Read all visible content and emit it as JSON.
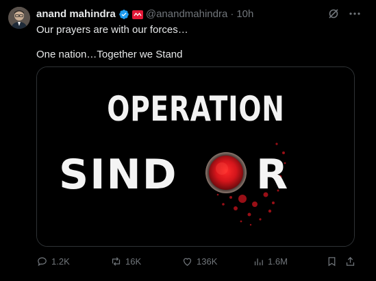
{
  "tweet": {
    "author_name": "anand mahindra",
    "handle": "@anandmahindra",
    "separator": "·",
    "time": "10h",
    "text_line1": "Our prayers are with our forces…",
    "text_line2": "One nation…Together we Stand"
  },
  "media": {
    "headline_top": "OPERATION",
    "headline_bottom_left": "SIND",
    "headline_bottom_right": "R"
  },
  "actions": {
    "replies": "1.2K",
    "reposts": "16K",
    "likes": "136K",
    "views": "1.6M"
  },
  "colors": {
    "background": "#000000",
    "text": "#e7e9ea",
    "muted": "#71767b",
    "verified": "#1d9bf0",
    "sindoor_red": "#c4161c"
  }
}
